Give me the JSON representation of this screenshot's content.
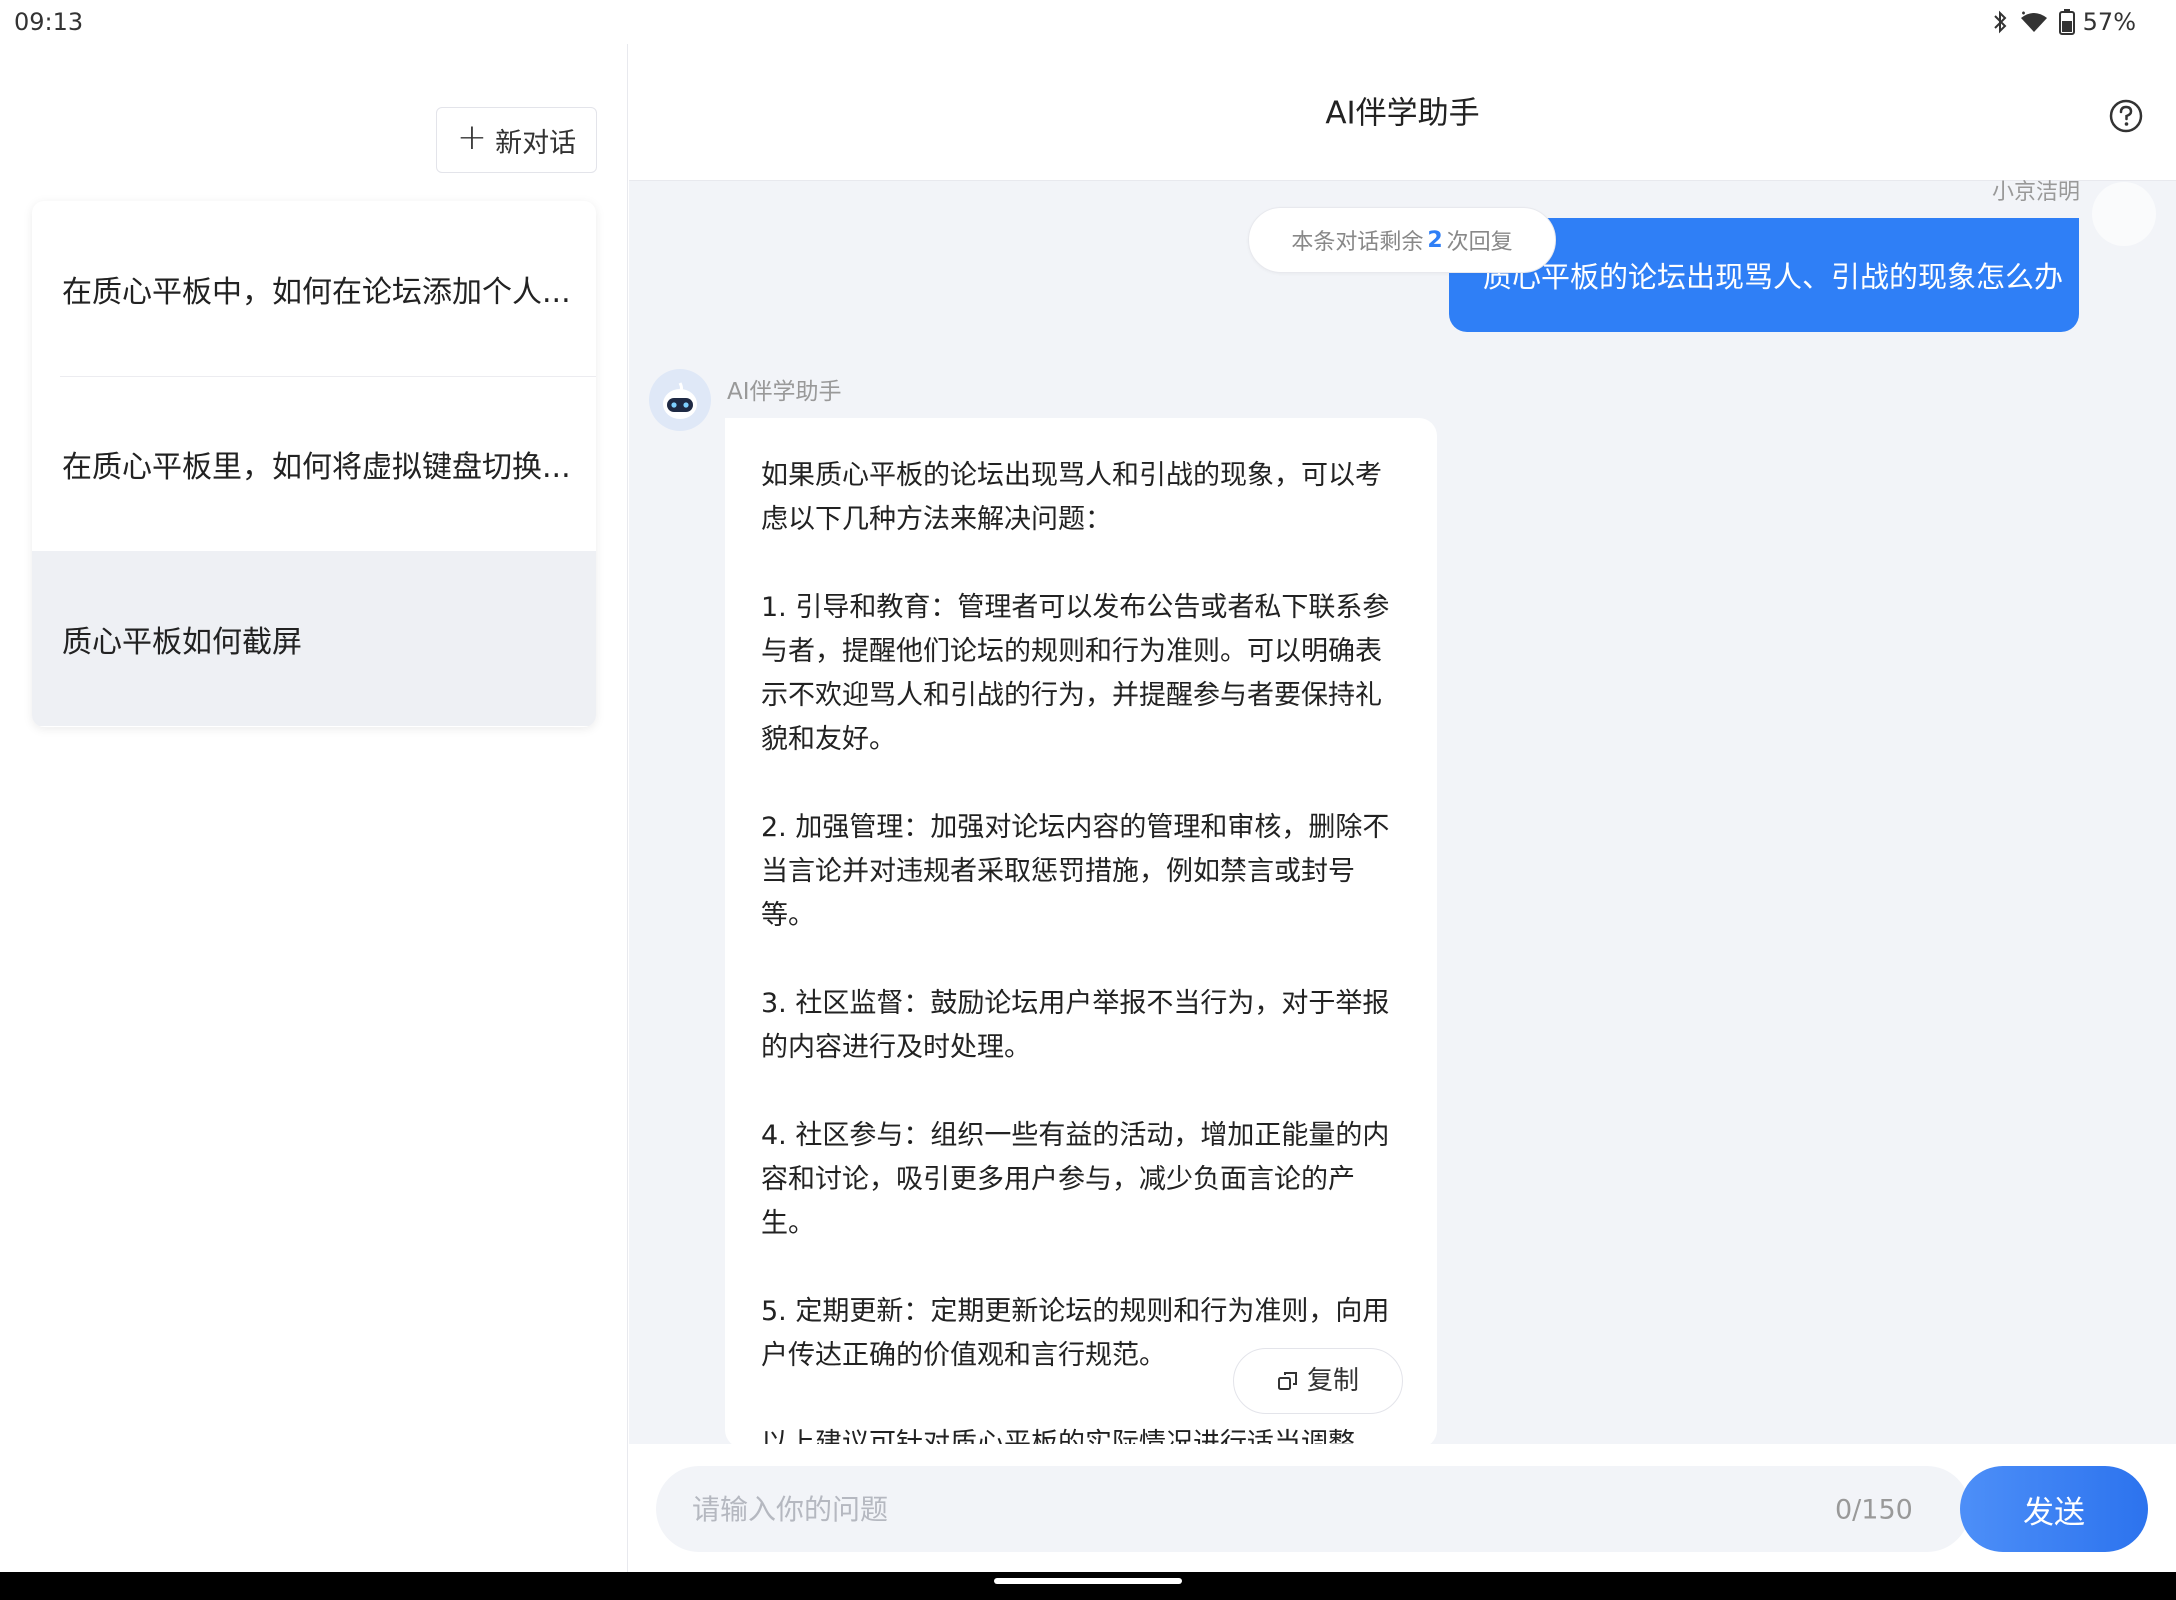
{
  "status_bar": {
    "time": "09:13",
    "battery": "57%",
    "icons": [
      "bluetooth-icon",
      "wifi-icon",
      "battery-icon"
    ]
  },
  "sidebar": {
    "new_chat_label": "新对话",
    "history": [
      {
        "title": "在质心平板中，如何在论坛添加个人...",
        "active": false
      },
      {
        "title": "在质心平板里，如何将虚拟键盘切换...",
        "active": false
      },
      {
        "title": "质心平板如何截屏",
        "active": true
      }
    ]
  },
  "header": {
    "title": "AI伴学助手",
    "help_icon": "help-circle-icon"
  },
  "conversation": {
    "user_name": "小京洁明",
    "user_message": "质心平板的论坛出现骂人、引战的现象怎么办",
    "remaining": {
      "prefix": "本条对话剩余",
      "count": "2",
      "suffix": "次回复"
    },
    "bot_name": "AI伴学助手",
    "bot_paragraphs": [
      "如果质心平板的论坛出现骂人和引战的现象，可以考虑以下几种方法来解决问题：",
      "1. 引导和教育：管理者可以发布公告或者私下联系参与者，提醒他们论坛的规则和行为准则。可以明确表示不欢迎骂人和引战的行为，并提醒参与者要保持礼貌和友好。",
      "2. 加强管理：加强对论坛内容的管理和审核，删除不当言论并对违规者采取惩罚措施，例如禁言或封号等。",
      "3. 社区监督：鼓励论坛用户举报不当行为，对于举报的内容进行及时处理。",
      "4. 社区参与：组织一些有益的活动，增加正能量的内容和讨论，吸引更多用户参与，减少负面言论的产生。",
      "5. 定期更新：定期更新论坛的规则和行为准则，向用户传达正确的价值观和言行规范。",
      "以上建议可针对质心平板的实际情况进行适当调整，以改善论坛氛围并提高用户满意度。"
    ],
    "copy_label": "复制"
  },
  "composer": {
    "placeholder": "请输入你的问题",
    "value": "",
    "counter": "0/150",
    "send_label": "发送"
  },
  "colors": {
    "accent": "#2f7ff6",
    "main_bg": "#f2f4f8",
    "active_item_bg": "#eef0f4"
  }
}
